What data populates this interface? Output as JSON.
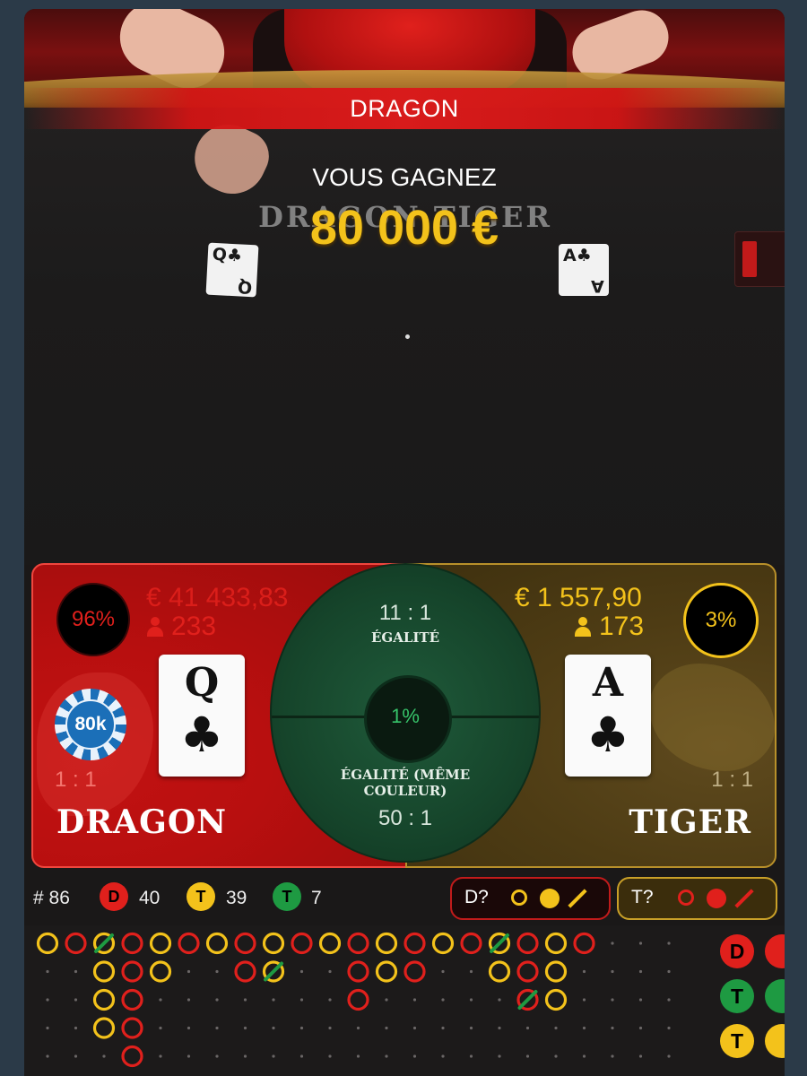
{
  "result": {
    "banner": "DRAGON",
    "win_label": "VOUS GAGNEZ",
    "win_amount": "80 000 €"
  },
  "table_logo": "DRAGON TIGER",
  "table_cards": {
    "dragon": {
      "rank": "Q",
      "suit": "♣"
    },
    "tiger": {
      "rank": "A",
      "suit": "♣"
    }
  },
  "dragon": {
    "percent": "96%",
    "stake": "€ 41 433,83",
    "players": "233",
    "card_rank": "Q",
    "card_suit": "♣",
    "chip": "80k",
    "payout": "1 : 1",
    "title": "DRAGON",
    "color": "#e0201c"
  },
  "tiger": {
    "percent": "3%",
    "stake": "€ 1 557,90",
    "players": "173",
    "card_rank": "A",
    "card_suit": "♣",
    "payout": "1 : 1",
    "title": "TIGER",
    "color": "#f3c21b"
  },
  "tie": {
    "percent": "1%",
    "odds": "11 : 1",
    "label": "ÉGALITÉ",
    "suited_label": "ÉGALITÉ (MÊME COULEUR)",
    "suited_odds": "50 : 1",
    "color": "#37c46a"
  },
  "stats": {
    "round": "# 86",
    "dragon_badge": "D",
    "dragon_count": "40",
    "tiger_badge": "T",
    "tiger_count": "39",
    "tie_badge": "T",
    "tie_count": "7"
  },
  "predictions": {
    "dragon": "D?",
    "tiger": "T?"
  },
  "big_road_side": [
    "D",
    "T",
    "T"
  ],
  "bead_road": {
    "cols": [
      [
        {
          "c": "y"
        }
      ],
      [
        {
          "c": "r"
        }
      ],
      [
        {
          "c": "y",
          "tie": true
        },
        {
          "c": "y"
        },
        {
          "c": "y"
        },
        {
          "c": "y"
        }
      ],
      [
        {
          "c": "r"
        },
        {
          "c": "r"
        },
        {
          "c": "r"
        },
        {
          "c": "r"
        },
        {
          "c": "r"
        }
      ],
      [
        {
          "c": "y"
        },
        {
          "c": "y"
        }
      ],
      [
        {
          "c": "r"
        }
      ],
      [
        {
          "c": "y"
        }
      ],
      [
        {
          "c": "r"
        },
        {
          "c": "r"
        }
      ],
      [
        {
          "c": "y"
        },
        {
          "c": "y",
          "tie": true
        }
      ],
      [
        {
          "c": "r"
        }
      ],
      [
        {
          "c": "y"
        }
      ],
      [
        {
          "c": "r"
        },
        {
          "c": "r"
        },
        {
          "c": "r"
        }
      ],
      [
        {
          "c": "y"
        },
        {
          "c": "y"
        }
      ],
      [
        {
          "c": "r"
        },
        {
          "c": "r"
        }
      ],
      [
        {
          "c": "y"
        }
      ],
      [
        {
          "c": "r"
        }
      ],
      [
        {
          "c": "y",
          "tie": true
        },
        {
          "c": "y"
        }
      ],
      [
        {
          "c": "r"
        },
        {
          "c": "r"
        },
        {
          "c": "r",
          "tie": true
        }
      ],
      [
        {
          "c": "y"
        },
        {
          "c": "y"
        },
        {
          "c": "y"
        }
      ],
      [
        {
          "c": "r"
        }
      ]
    ],
    "colors": {
      "r": "#e0201c",
      "y": "#f3c21b",
      "tie": "#1e9a42"
    }
  }
}
